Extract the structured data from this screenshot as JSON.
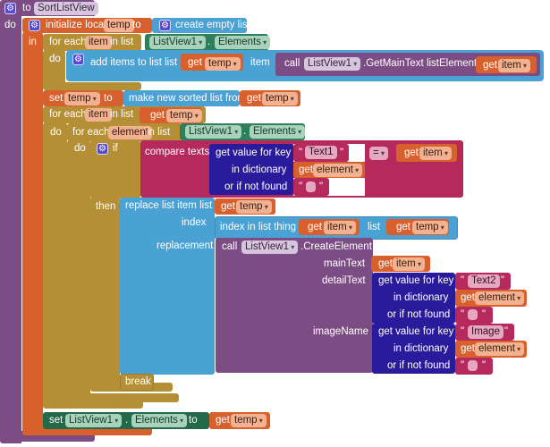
{
  "procedure": {
    "to_label": "to",
    "name": "SortListView",
    "do_label": "do"
  },
  "init_local": {
    "label": "initialize local",
    "var_name": "temp",
    "to_label": "to",
    "in_label": "in",
    "value_label": "create empty list"
  },
  "foreach1": {
    "label": "for each",
    "var_name": "item",
    "in_list_label": "in list",
    "component": "ListView1",
    "dot": ".",
    "property": "Elements",
    "do_label": "do"
  },
  "add_items": {
    "label": "add items to list  list",
    "get_label": "get",
    "get_var": "temp",
    "item_label": "item",
    "call_label": "call",
    "component": "ListView1",
    "method": ".GetMainText  listElement",
    "arg_get_label": "get",
    "arg_var": "item"
  },
  "set_temp": {
    "set_label": "set",
    "var": "temp",
    "to_label": "to",
    "sorted_label": "make new sorted list from",
    "get_label": "get",
    "get_var": "temp"
  },
  "foreach2": {
    "label": "for each",
    "var_name": "item",
    "in_list_label": "in list",
    "get_label": "get",
    "get_var": "temp",
    "do_label": "do"
  },
  "foreach3": {
    "label": "for each",
    "var_name": "element",
    "in_list_label": "in list",
    "component": "ListView1",
    "dot": ".",
    "property": "Elements",
    "do_label": "do"
  },
  "if_block": {
    "if_label": "if",
    "then_label": "then",
    "compare_label": "compare texts",
    "operator": "=",
    "rhs_get_label": "get",
    "rhs_var": "item",
    "dict_lookup": {
      "key_label": "get value for key",
      "key_value": "Text1",
      "dict_label": "in dictionary",
      "dict_get_label": "get",
      "dict_var": "element",
      "notfound_label": "or if not found",
      "notfound_value": ""
    }
  },
  "replace": {
    "label": "replace list item  list",
    "get_label": "get",
    "get_var": "temp",
    "index_label": "index",
    "index_in_list_label": "index in list  thing",
    "thing_get_label": "get",
    "thing_var": "item",
    "list_label": "list",
    "list_get_label": "get",
    "list_var": "temp",
    "replacement_label": "replacement"
  },
  "create_element": {
    "call_label": "call",
    "component": "ListView1",
    "method": ".CreateElement",
    "main_text_label": "mainText",
    "main_get_label": "get",
    "main_var": "item",
    "detail_label": "detailText",
    "detail_lookup": {
      "key_label": "get value for key",
      "key_value": "Text2",
      "dict_label": "in dictionary",
      "dict_get_label": "get",
      "dict_var": "element",
      "notfound_label": "or if not found",
      "notfound_value": ""
    },
    "image_label": "imageName",
    "image_lookup": {
      "key_label": "get value for key",
      "key_value": "Image",
      "dict_label": "in dictionary",
      "dict_get_label": "get",
      "dict_var": "element",
      "notfound_label": "or if not found",
      "notfound_value": ""
    }
  },
  "break_label": "break",
  "set_elements": {
    "set_label": "set",
    "component": "ListView1",
    "dot": ".",
    "property": "Elements",
    "to_label": "to",
    "get_label": "get",
    "get_var": "temp"
  },
  "icons": {
    "gear": "⚙",
    "quote": "\""
  }
}
